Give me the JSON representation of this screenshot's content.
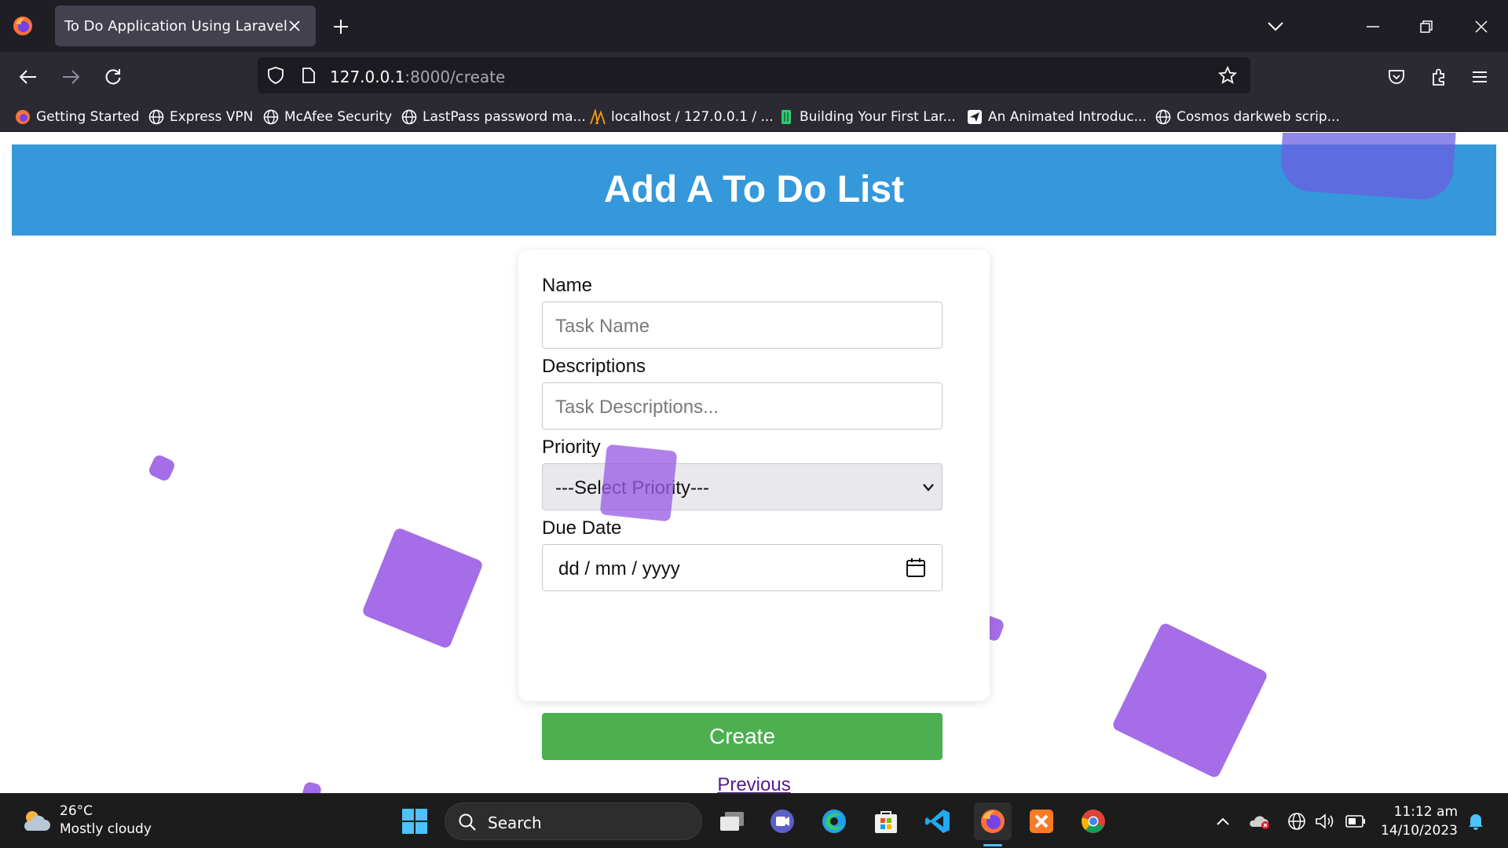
{
  "browser": {
    "tab_title": "To Do Application Using Laravel",
    "url_host": "127.0.0.1",
    "url_path": ":8000/create",
    "bookmarks": [
      {
        "label": "Getting Started",
        "icon": "firefox-icon"
      },
      {
        "label": "Express VPN",
        "icon": "globe-icon"
      },
      {
        "label": "McAfee Security",
        "icon": "globe-icon"
      },
      {
        "label": "LastPass password ma...",
        "icon": "globe-icon"
      },
      {
        "label": "localhost / 127.0.0.1 / ...",
        "icon": "phpmyadmin-icon"
      },
      {
        "label": "Building Your First Lar...",
        "icon": "book-icon"
      },
      {
        "label": "An Animated Introduc...",
        "icon": "send-icon"
      },
      {
        "label": "Cosmos darkweb scrip...",
        "icon": "globe-icon"
      }
    ]
  },
  "page": {
    "title": "Add A To Do List",
    "form": {
      "name_label": "Name",
      "name_placeholder": "Task Name",
      "desc_label": "Descriptions",
      "desc_placeholder": "Task Descriptions...",
      "priority_label": "Priority",
      "priority_selected": "---Select Priority---",
      "due_label": "Due Date",
      "due_value": "dd / mm / yyyy",
      "create_label": "Create",
      "previous_label": "Previous"
    }
  },
  "taskbar": {
    "weather_temp": "26°C",
    "weather_desc": "Mostly cloudy",
    "search_label": "Search",
    "time": "11:12 am",
    "date": "14/10/2023"
  },
  "colors": {
    "header": "#3498db",
    "shape": "#9b5de5",
    "create": "#4caf50"
  }
}
